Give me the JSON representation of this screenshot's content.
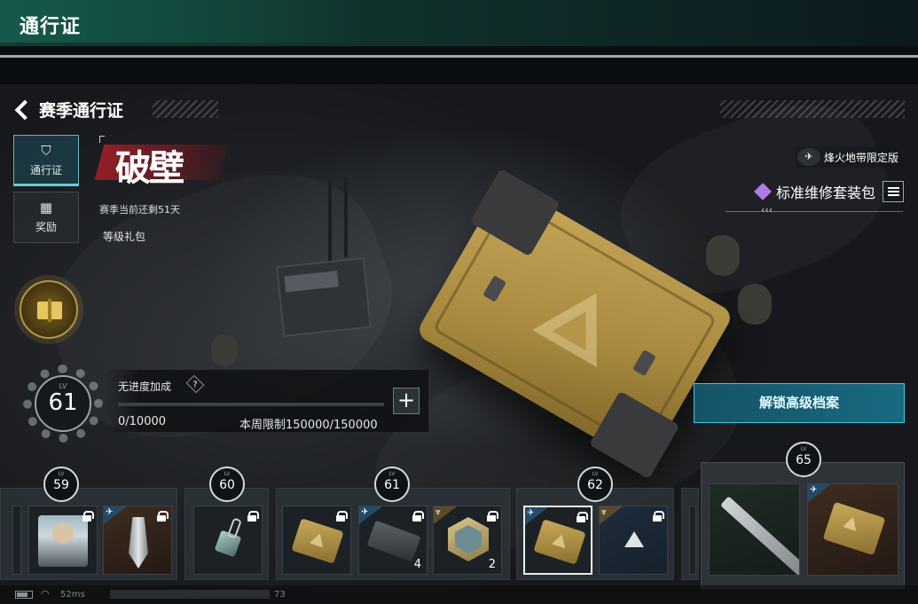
{
  "topbar": {
    "title": "通行证"
  },
  "header": {
    "back_title": "赛季通行证"
  },
  "tabs": [
    {
      "label": "通行证",
      "icon": "shield-bolt-icon"
    },
    {
      "label": "奖励",
      "icon": "gift-icon"
    }
  ],
  "season": {
    "logo_text": "破壁",
    "remaining": "赛季当前还剩51天"
  },
  "level_gift": {
    "label": "等级礼包"
  },
  "level": {
    "lv_label": "LV",
    "value": "61"
  },
  "progress": {
    "label": "无进度加成",
    "help": "?",
    "current": "0/10000",
    "fraction": 0,
    "weekly_limit": "本周限制150000/150000",
    "plus": "+"
  },
  "edition": {
    "label": "烽火地带限定版",
    "icon": "helicopter-icon"
  },
  "item": {
    "name": "标准维修套装包",
    "rarity_color": "#b07ae6"
  },
  "unlock_button": "解锁高级档案",
  "track": {
    "levels": [
      {
        "lv": "LV",
        "num": "59"
      },
      {
        "lv": "LV",
        "num": "60"
      },
      {
        "lv": "LV",
        "num": "61"
      },
      {
        "lv": "LV",
        "num": "62"
      },
      {
        "lv": "LV",
        "num": "65"
      }
    ],
    "rewards": [
      {
        "name": "soldier-skin",
        "qty": ""
      },
      {
        "name": "blade-skin",
        "qty": ""
      },
      {
        "name": "keychain-charm",
        "qty": ""
      },
      {
        "name": "gold-crate",
        "qty": ""
      },
      {
        "name": "weapon-case",
        "qty": "4"
      },
      {
        "name": "hex-badge",
        "qty": "2"
      },
      {
        "name": "gold-crate",
        "qty": ""
      },
      {
        "name": "triangle-emblem",
        "qty": ""
      },
      {
        "name": "rifle-skin",
        "qty": ""
      },
      {
        "name": "gold-crate",
        "qty": ""
      }
    ]
  },
  "status": {
    "ping": "52ms",
    "fps": "73"
  },
  "colors": {
    "accent": "#5fd0e0",
    "topbar": "#16594b",
    "gold": "#c7a75a"
  }
}
